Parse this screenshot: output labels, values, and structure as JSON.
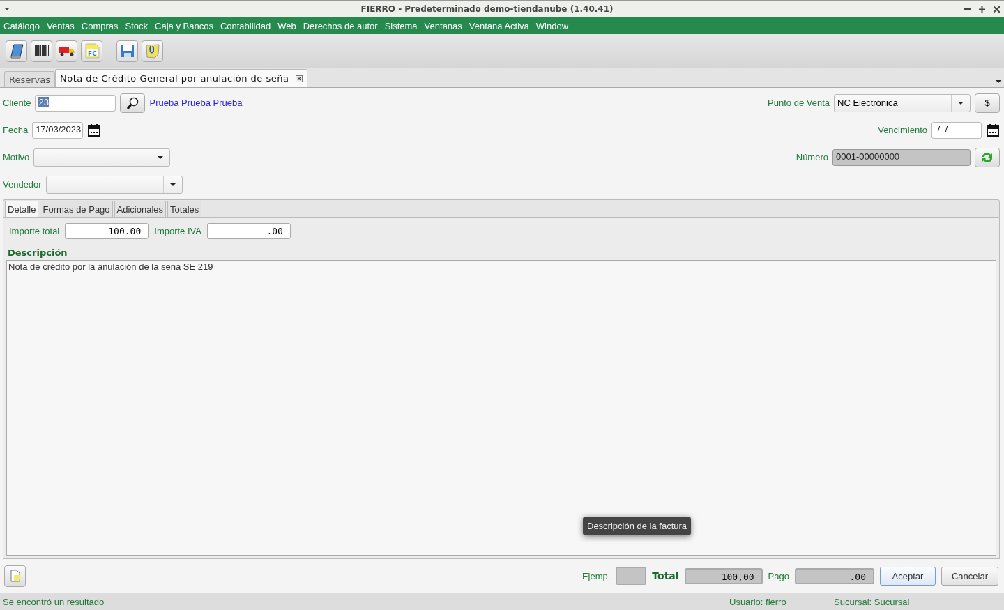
{
  "window": {
    "title": "FIERRO - Predeterminado demo-tiendanube (1.40.41)"
  },
  "menu": [
    "Catálogo",
    "Ventas",
    "Compras",
    "Stock",
    "Caja y Bancos",
    "Contabilidad",
    "Web",
    "Derechos de autor",
    "Sistema",
    "Ventanas",
    "Ventana Activa",
    "Window"
  ],
  "toolbar": [
    {
      "kind": "book"
    },
    {
      "kind": "barcode"
    },
    {
      "kind": "truck"
    },
    {
      "kind": "invoice",
      "text": "FC"
    },
    {
      "kind": "separator"
    },
    {
      "kind": "save"
    },
    {
      "kind": "note"
    }
  ],
  "doc_tabs": [
    {
      "label": "Reservas",
      "selected": false,
      "closable": false
    },
    {
      "label": "Nota de Crédito General por anulación de seña",
      "selected": true,
      "closable": true
    }
  ],
  "form": {
    "cliente": {
      "label": "Cliente",
      "value": "23",
      "name": "Prueba Prueba Prueba"
    },
    "fecha": {
      "label": "Fecha",
      "value": "17/03/2023"
    },
    "motivo": {
      "label": "Motivo"
    },
    "vendedor": {
      "label": "Vendedor"
    },
    "punto_de_venta": {
      "label": "Punto de Venta",
      "value": "NC Electrónica",
      "button": "$"
    },
    "vencimiento": {
      "label": "Vencimiento",
      "value": " /  /"
    },
    "numero": {
      "label": "Número",
      "value": "0001-00000000"
    }
  },
  "detail_tabs": [
    {
      "label": "Detalle",
      "selected": true
    },
    {
      "label": "Formas de Pago",
      "selected": false
    },
    {
      "label": "Adicionales",
      "selected": false
    },
    {
      "label": "Totales",
      "selected": false
    }
  ],
  "importe_total": {
    "label": "Importe total",
    "value": "100.00"
  },
  "importe_iva": {
    "label": "Importe IVA",
    "value": ".00"
  },
  "descripcion": {
    "label": "Descripción",
    "value": "Nota de crédito por la anulación de la seña SE 219"
  },
  "tooltip": "Descripción de la factura",
  "footer": {
    "ejemplares": {
      "label": "Ejemp."
    },
    "total": {
      "label": "Total",
      "value": "100,00"
    },
    "pago": {
      "label": "Pago",
      "value": ".00"
    },
    "buttons": [
      "Aceptar",
      "Cancelar"
    ]
  },
  "status_bar": {
    "message": "Se encontró un resultado",
    "user": "Usuario: fierro",
    "branch": "Sucursal: Sucursal"
  }
}
